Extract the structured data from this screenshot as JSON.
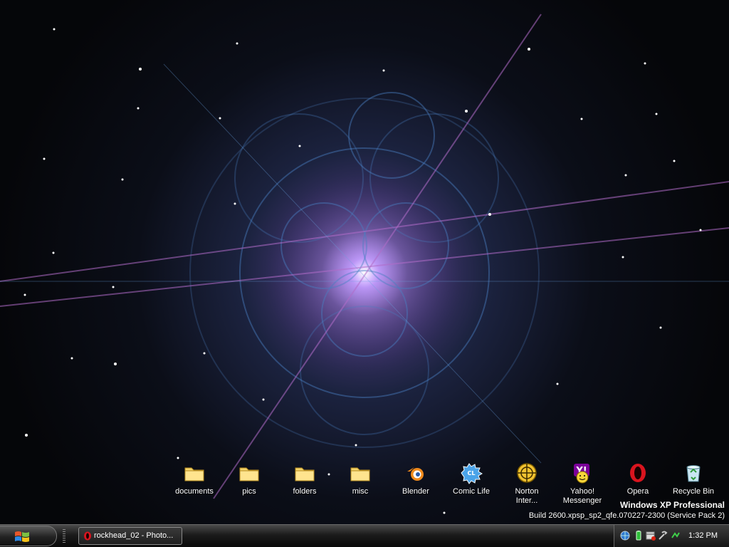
{
  "desktop": {
    "icons": [
      {
        "label": "documents",
        "icon": "folder-icon"
      },
      {
        "label": "pics",
        "icon": "folder-icon"
      },
      {
        "label": "folders",
        "icon": "folder-icon"
      },
      {
        "label": "misc",
        "icon": "folder-icon"
      },
      {
        "label": "Blender",
        "icon": "blender-icon"
      },
      {
        "label": "Comic Life",
        "icon": "comic-life-icon"
      },
      {
        "label": "Norton\nInter...",
        "icon": "norton-icon"
      },
      {
        "label": "Yahoo!\nMessenger",
        "icon": "yahoo-messenger-icon"
      },
      {
        "label": "Opera",
        "icon": "opera-icon"
      },
      {
        "label": "Recycle Bin",
        "icon": "recycle-bin-icon"
      }
    ],
    "watermark": {
      "edition": "Windows XP Professional",
      "build": "Build 2600.xpsp_sp2_qfe.070227-2300 (Service Pack 2)"
    }
  },
  "taskbar": {
    "start_icon": "windows-flag-icon",
    "tasks": [
      {
        "label": "rockhead_02 - Photo...",
        "icon": "opera-icon"
      }
    ],
    "tray_icons": [
      "network-globe-icon",
      "battery-icon",
      "calendar-alert-icon",
      "tools-icon",
      "network-connection-icon"
    ],
    "clock": "1:32 PM"
  },
  "colors": {
    "folder": "#f4d46a",
    "opera_red": "#d9141e",
    "yahoo_purple": "#7b0099",
    "taskbar_dark": "#1b1b1b"
  }
}
